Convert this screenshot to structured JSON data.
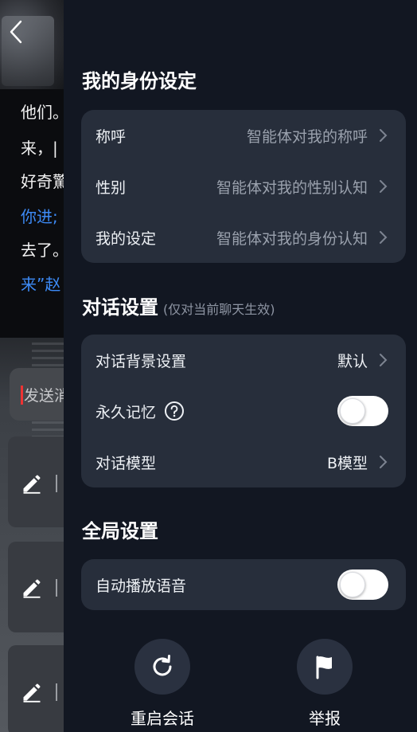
{
  "background_chat": {
    "lines": [
      {
        "text": "他们。",
        "style": "white"
      },
      {
        "text": "来，|",
        "style": "white"
      },
      {
        "text": "好奇驚",
        "style": "white"
      },
      {
        "text": "你进;",
        "style": "blue"
      },
      {
        "text": "去了。",
        "style": "white"
      },
      {
        "text": "来”赵",
        "style": "mixed"
      }
    ],
    "input_placeholder": "发送消"
  },
  "identity": {
    "title": "我的身份设定",
    "rows": [
      {
        "label": "称呼",
        "value": "智能体对我的称呼"
      },
      {
        "label": "性别",
        "value": "智能体对我的性别认知"
      },
      {
        "label": "我的设定",
        "value": "智能体对我的身份认知"
      }
    ]
  },
  "dialog": {
    "title": "对话设置",
    "subtitle": "(仅对当前聊天生效)",
    "background_label": "对话背景设置",
    "background_value": "默认",
    "memory_label": "永久记忆",
    "memory_enabled": false,
    "model_label": "对话模型",
    "model_value": "B模型"
  },
  "global": {
    "title": "全局设置",
    "autoplay_label": "自动播放语音",
    "autoplay_enabled": false
  },
  "actions": {
    "restart_label": "重启会话",
    "report_label": "举报"
  },
  "icons": {
    "back": "chevron-left-icon",
    "chevron": "chevron-right-icon",
    "help": "question-circle-icon",
    "restart": "refresh-icon",
    "report": "flag-icon",
    "edit": "pencil-icon"
  },
  "colors": {
    "panel_bg": "#121722",
    "card_bg": "#272e3b",
    "link_blue": "#3d8bf7",
    "muted_text": "#9aa1ad"
  }
}
